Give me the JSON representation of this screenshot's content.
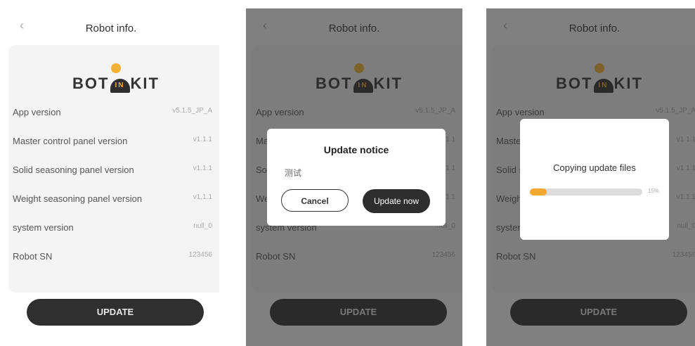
{
  "header": {
    "title": "Robot info."
  },
  "logo": {
    "text_left": "BOT",
    "text_mark": "IN",
    "text_right": "KIT"
  },
  "info_rows": [
    {
      "label": "App version",
      "value": "v5.1.5_JP_A"
    },
    {
      "label": "Master control panel version",
      "value": "v1.1.1"
    },
    {
      "label": "Solid seasoning panel version",
      "value": "v1.1.1"
    },
    {
      "label": "Weight seasoning panel version",
      "value": "v1.1.1"
    },
    {
      "label": "system version",
      "value": "null_0"
    },
    {
      "label": "Robot SN",
      "value": "123456"
    }
  ],
  "update_button": {
    "label": "UPDATE"
  },
  "update_notice": {
    "title": "Update notice",
    "message": "测试",
    "cancel_label": "Cancel",
    "confirm_label": "Update now"
  },
  "copying_dialog": {
    "title": "Copying update files",
    "progress": 0.15,
    "progress_text": "15%"
  },
  "colors": {
    "accent": "#f2a830",
    "dark": "#2e2e2e"
  }
}
